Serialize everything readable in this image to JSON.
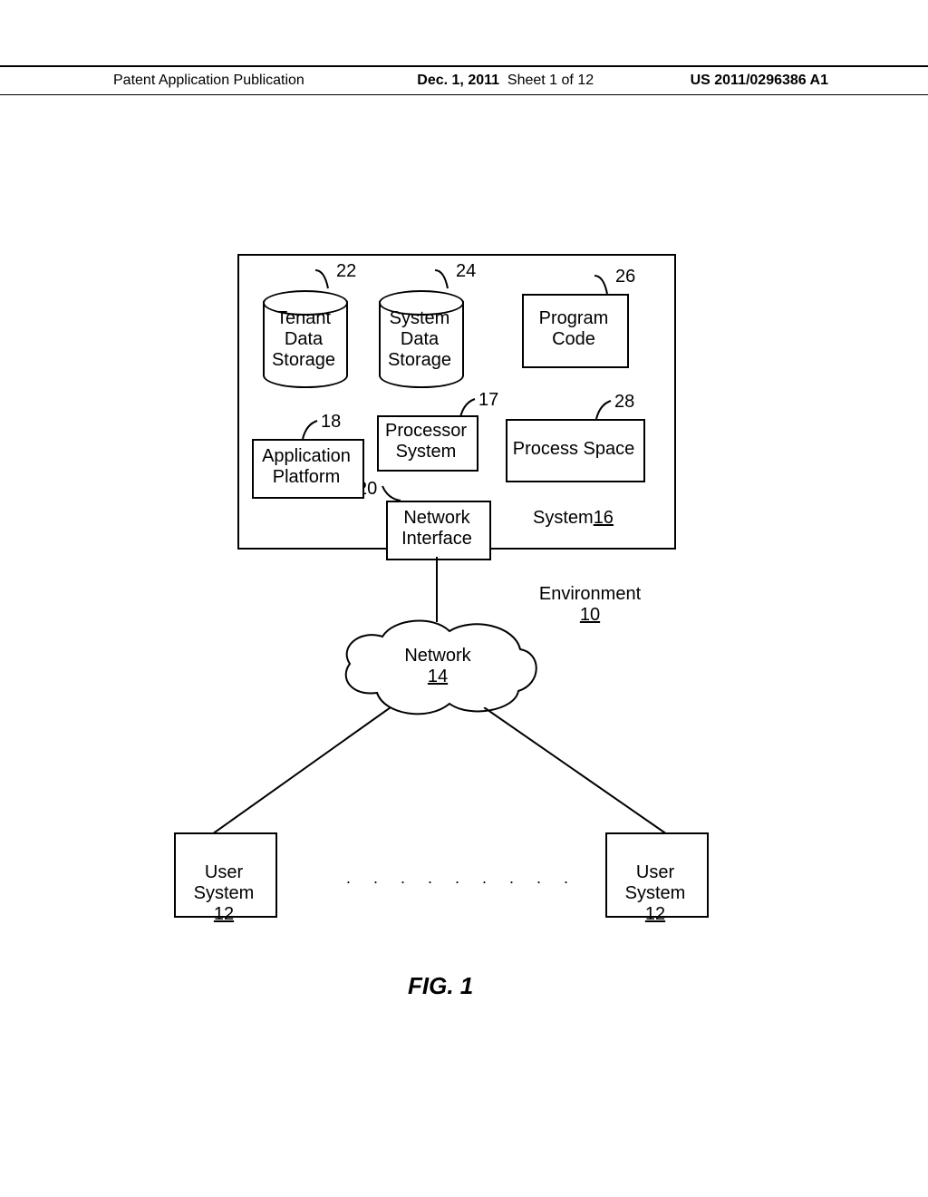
{
  "header": {
    "publication": "Patent Application Publication",
    "date": "Dec. 1, 2011",
    "sheet": "Sheet 1 of 12",
    "docnum": "US 2011/0296386 A1"
  },
  "refs": {
    "r22": "22",
    "r24": "24",
    "r26": "26",
    "r17": "17",
    "r28": "28",
    "r18": "18",
    "r20": "20"
  },
  "blocks": {
    "tenant": "Tenant\nData\nStorage",
    "systemdata": "System\nData\nStorage",
    "program": "Program\nCode",
    "processor": "Processor\nSystem",
    "process_space": "Process Space",
    "application": "Application\nPlatform",
    "netif": "Network\nInterface",
    "system_label": "System",
    "system_num": "16",
    "env_label": "Environment",
    "env_num": "10",
    "network_label": "Network",
    "network_num": "14",
    "user_label": "User\nSystem",
    "user_num": "12"
  },
  "figure": "FIG. 1"
}
